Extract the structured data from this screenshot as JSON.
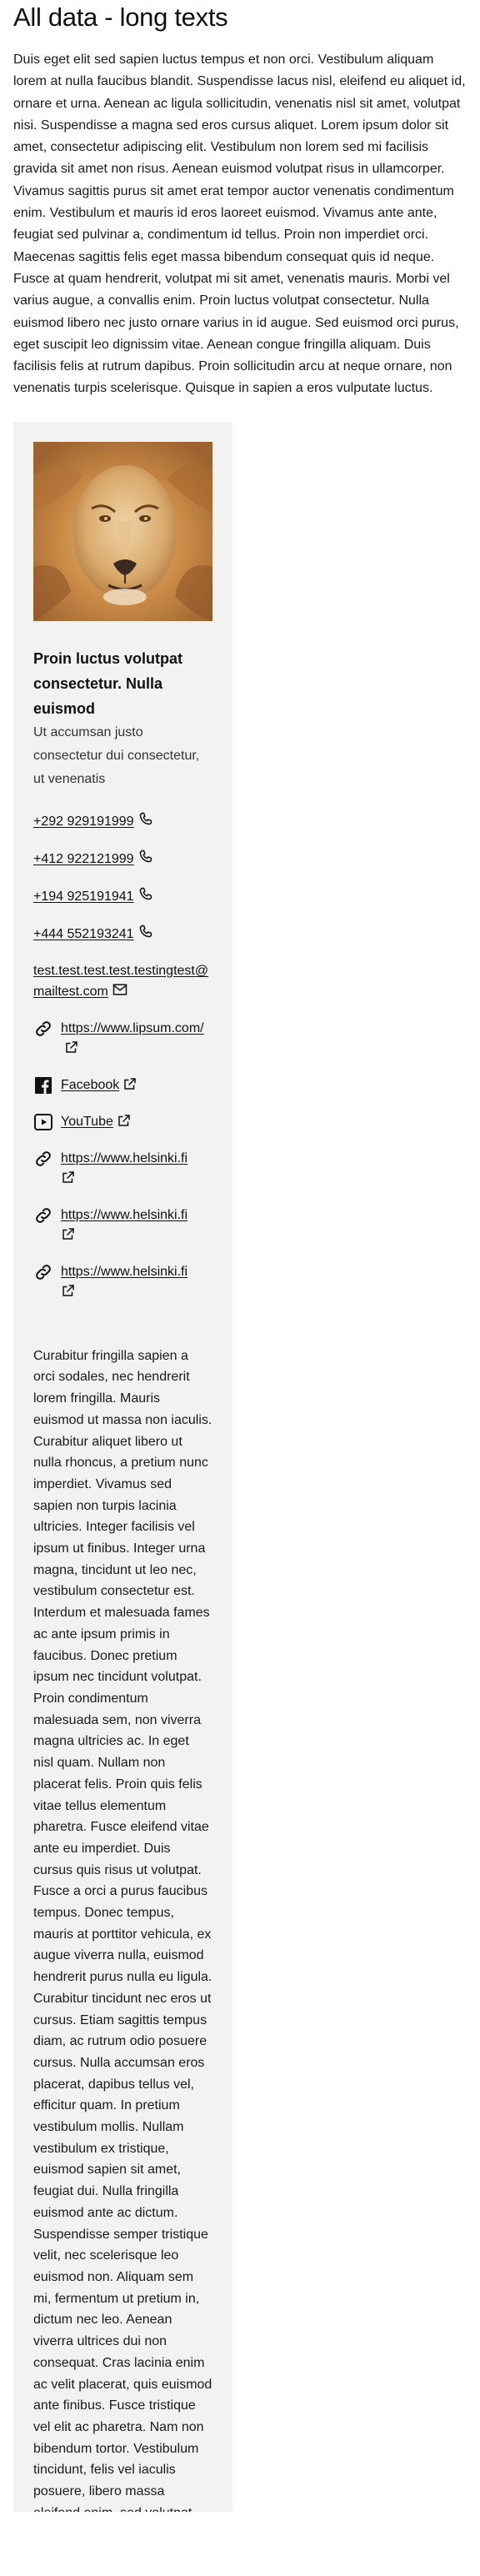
{
  "page": {
    "title": "All data - long texts",
    "intro": "Duis eget elit sed sapien luctus tempus et non orci. Vestibulum aliquam lorem at nulla faucibus blandit. Suspendisse lacus nisl, eleifend eu aliquet id, ornare et urna. Aenean ac ligula sollicitudin, venenatis nisl sit amet, volutpat nisi. Suspendisse a magna sed eros cursus aliquet. Lorem ipsum dolor sit amet, consectetur adipiscing elit. Vestibulum non lorem sed mi facilisis gravida sit amet non risus. Aenean euismod volutpat risus in ullamcorper. Vivamus sagittis purus sit amet erat tempor auctor venenatis condimentum enim. Vestibulum et mauris id eros laoreet euismod. Vivamus ante ante, feugiat sed pulvinar a, condimentum id tellus. Proin non imperdiet orci. Maecenas sagittis felis eget massa bibendum consequat quis id neque. Fusce at quam hendrerit, volutpat mi sit amet, venenatis mauris. Morbi vel varius augue, a convallis enim. Proin luctus volutpat consectetur. Nulla euismod libero nec justo ornare varius in id augue. Sed euismod orci purus, eget suscipit leo dignissim vitae. Aenean congue fringilla aliquam. Duis facilisis felis at rutrum dapibus. Proin sollicitudin arcu at neque ornare, non venenatis turpis scelerisque. Quisque in sapien a eros vulputate luctus."
  },
  "card": {
    "title": "Proin luctus volutpat consectetur. Nulla euismod",
    "subtitle": "Ut accumsan justo consectetur dui consectetur, ut venenatis",
    "phones": [
      "+292 929191999",
      "+412 922121999",
      "+194 925191941",
      "+444 552193241"
    ],
    "email": "test.test.test.test.testingtest@mailtest.com",
    "links": [
      {
        "icon": "link-icon",
        "label": "https://www.lipsum.com/"
      },
      {
        "icon": "facebook-icon",
        "label": "Facebook"
      },
      {
        "icon": "youtube-icon",
        "label": "YouTube"
      },
      {
        "icon": "link-icon",
        "label": "https://www.helsinki.fi"
      },
      {
        "icon": "link-icon",
        "label": "https://www.helsinki.fi"
      },
      {
        "icon": "link-icon",
        "label": "https://www.helsinki.fi"
      }
    ],
    "long_text": "Curabitur fringilla sapien a orci sodales, nec hendrerit lorem fringilla. Mauris euismod ut massa non iaculis. Curabitur aliquet libero ut nulla rhoncus, a pretium nunc imperdiet. Vivamus sed sapien non turpis lacinia ultricies. Integer facilisis vel ipsum ut finibus. Integer urna magna, tincidunt ut leo nec, vestibulum consectetur est. Interdum et malesuada fames ac ante ipsum primis in faucibus. Donec pretium ipsum nec tincidunt volutpat. Proin condimentum malesuada sem, non viverra magna ultricies ac. In eget nisl quam. Nullam non placerat felis. Proin quis felis vitae tellus elementum pharetra. Fusce eleifend vitae ante eu imperdiet. Duis cursus quis risus ut volutpat. Fusce a orci a purus faucibus tempus. Donec tempus, mauris at porttitor vehicula, ex augue viverra nulla, euismod hendrerit purus nulla eu ligula. Curabitur tincidunt nec eros ut cursus. Etiam sagittis tempus diam, ac rutrum odio posuere cursus. Nulla accumsan eros placerat, dapibus tellus vel, efficitur quam. In pretium vestibulum mollis. Nullam vestibulum ex tristique, euismod sapien sit amet, feugiat dui. Nulla fringilla euismod ante ac dictum. Suspendisse semper tristique velit, nec scelerisque leo euismod non. Aliquam sem mi, fermentum ut pretium in, dictum nec leo. Aenean viverra ultrices dui non consequat. Cras lacinia enim ac velit placerat, quis euismod ante finibus. Fusce tristique vel elit ac pharetra. Nam non bibendum tortor. Vestibulum tincidunt, felis vel iaculis posuere, libero massa eleifend enim, sed volutpat orci turpis eget urna."
  },
  "icons": {
    "phone": "phone-icon",
    "email": "envelope-icon",
    "external": "external-link-icon"
  }
}
